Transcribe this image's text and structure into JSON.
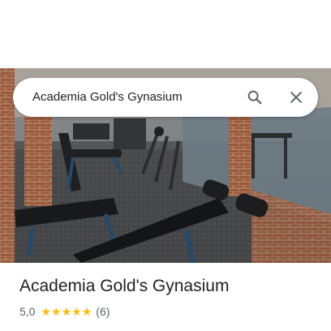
{
  "search": {
    "query": "Academia Gold's Gynasium"
  },
  "place": {
    "title": "Academia Gold's Gynasium",
    "rating": "5,0",
    "stars": 5,
    "review_count": "(6)"
  },
  "colors": {
    "star": "#fbbc04",
    "text_primary": "#202124",
    "text_secondary": "#5f6368"
  },
  "icons": {
    "search": "search-icon",
    "close": "close-icon",
    "star": "star-icon"
  }
}
